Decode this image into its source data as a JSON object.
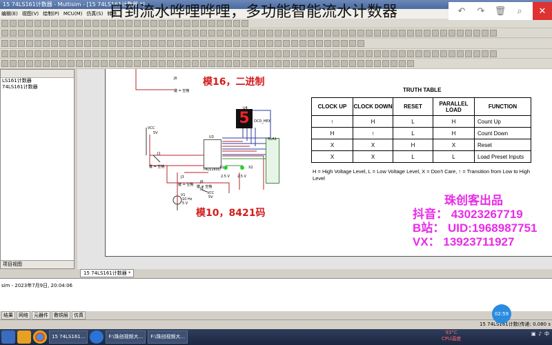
{
  "window_title": "15 74LS161计数器 - Multisim - [15 74LS161计数器 *]",
  "overlay_title": "日到流水哗哩哗哩，多功能智能流水计数器",
  "menu": [
    "编辑(E)",
    "视图(V)",
    "绘制(P)",
    "MCU(M)",
    "仿真(S)",
    "转移"
  ],
  "left_panel": {
    "items": [
      "LS161计数器",
      "74LS161计数器"
    ],
    "tab": "项目视图"
  },
  "document_tab": "15 74LS161计数器 *",
  "log_line": "sim - 2023年7月9日, 20:04:06",
  "bottom_tabs": [
    "结果",
    "网络",
    "元器件",
    "敷铜层",
    "仿真"
  ],
  "status_right": "15 74LS161计数(传递: 0.080 s",
  "clock_badge": "02:59",
  "temperature": {
    "value": "93°C",
    "label": "CPU温度"
  },
  "taskbar_tasks": [
    "15 74LS161...",
    "F:\\珠创视频大...",
    "F:\\珠创视频大..."
  ],
  "schematic": {
    "mod16_label": "模16，二进制",
    "mod10_label": "模10，8421码",
    "seven_seg_digit": "5",
    "labels": {
      "u4": "U4",
      "dcd_hex": "DCD_HEX",
      "u3": "U3",
      "chip": "74LS160D",
      "xla1": "XLA1",
      "vcc": "VCC",
      "vcc_v": "5V",
      "j1": "J1",
      "j3": "J3",
      "key_space": "键 = 空格",
      "x1": "X1",
      "x2": "X2",
      "x1_v": "2.5 V",
      "x2_v": "2.5 V",
      "j6": "J6",
      "v1": "V1",
      "v1_freq": "10 Hz",
      "v1_v": "5 V",
      "vcc2": "VCC",
      "vcc2_v": "5V",
      "j8": "J8"
    }
  },
  "truth_table": {
    "title": "TRUTH TABLE",
    "headers": [
      "CLOCK UP",
      "CLOCK DOWN",
      "RESET",
      "PARALLEL LOAD",
      "FUNCTION"
    ],
    "rows": [
      [
        "↑",
        "H",
        "L",
        "H",
        "Count Up"
      ],
      [
        "H",
        "↑",
        "L",
        "H",
        "Count Down"
      ],
      [
        "X",
        "X",
        "H",
        "X",
        "Reset"
      ],
      [
        "X",
        "X",
        "L",
        "L",
        "Load Preset Inputs"
      ]
    ],
    "note": "H = High Voltage Level, L = Low Voltage Level, X = Don't Care, ↑ = Transition from Low to High Level"
  },
  "ad": {
    "title": "珠创客出品",
    "line1": "抖音： 43023267719",
    "line2": "B站： UID:1968987751",
    "line3": "VX： 13923711927"
  },
  "colors": {
    "red_label": "#d21c1c",
    "ad_magenta": "#e82be8",
    "net_green": "#2a9d3a"
  }
}
